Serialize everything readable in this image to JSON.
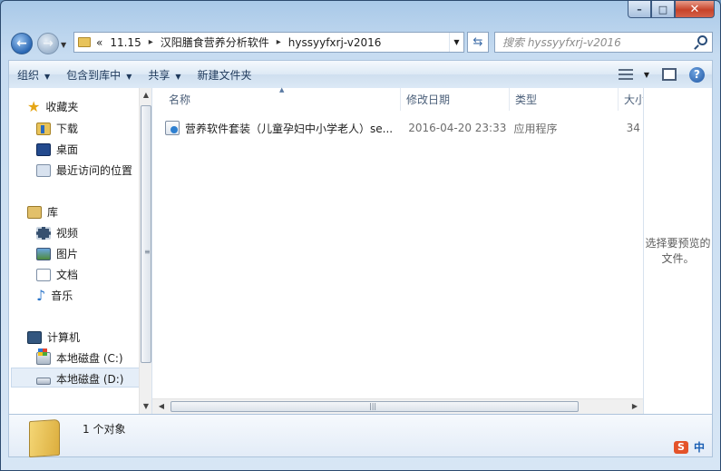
{
  "window": {
    "min": "–",
    "max": "□",
    "close": "✕"
  },
  "address": {
    "breadcrumb": [
      "«",
      "11.15",
      "汉阳膳食营养分析软件",
      "hyssyyfxrj-v2016"
    ],
    "separators": [
      "▸",
      "▸"
    ]
  },
  "search": {
    "placeholder": "搜索 hyssyyfxrj-v2016"
  },
  "toolbar": {
    "organize": "组织",
    "include_in_library": "包含到库中",
    "share": "共享",
    "new_folder": "新建文件夹"
  },
  "sidebar": {
    "favorites": {
      "label": "收藏夹",
      "items": [
        "下载",
        "桌面",
        "最近访问的位置"
      ]
    },
    "libraries": {
      "label": "库",
      "items": [
        "视频",
        "图片",
        "文档",
        "音乐"
      ]
    },
    "computer": {
      "label": "计算机",
      "items": [
        "本地磁盘 (C:)",
        "本地磁盘 (D:)"
      ],
      "selected": "本地磁盘 (D:)"
    }
  },
  "columns": {
    "name": "名称",
    "date": "修改日期",
    "type": "类型",
    "size": "大小"
  },
  "files": [
    {
      "name": "营养软件套装（儿童孕妇中小学老人）se...",
      "date": "2016-04-20 23:33",
      "type": "应用程序",
      "size": "34"
    }
  ],
  "preview": {
    "text": "选择要预览的文件。"
  },
  "details": {
    "count": "1 个对象"
  },
  "tray": {
    "ime_s": "S",
    "ime_zh": "中"
  },
  "colors": {
    "accent": "#2a67b3",
    "selection": "#e5eef8",
    "close": "#c7432a"
  }
}
